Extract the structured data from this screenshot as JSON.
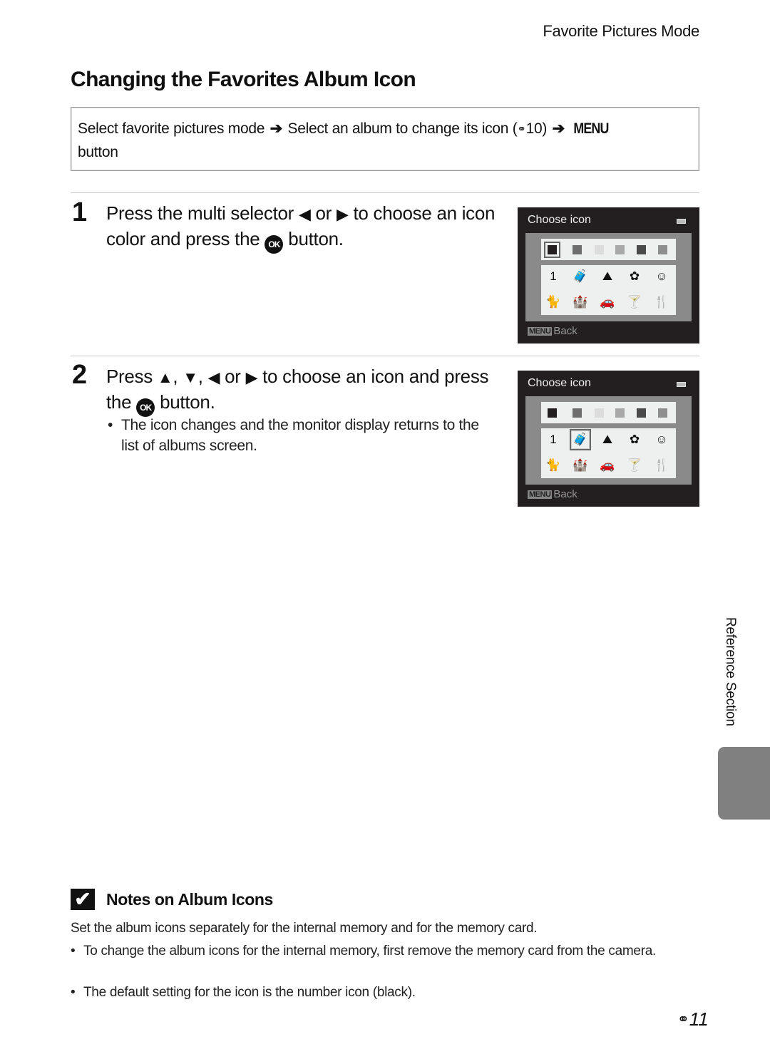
{
  "header": {
    "section": "Favorite Pictures Mode"
  },
  "title": "Changing the Favorites Album Icon",
  "navigation": {
    "part1": "Select favorite pictures mode",
    "arrow": "➔",
    "part2": "Select an album to change its icon (",
    "ref_icon": "⚭",
    "ref_page": "10)",
    "menu_label": "MENU",
    "part3": "button"
  },
  "steps": [
    {
      "number": "1",
      "text_a": "Press the multi selector ",
      "left": "◀",
      "or": " or ",
      "right": "▶",
      "text_b": " to choose an icon color and press the ",
      "ok": "OK",
      "text_c": " button."
    },
    {
      "number": "2",
      "text_a": "Press ",
      "up": "▲",
      "comma1": ", ",
      "down": "▼",
      "comma2": ", ",
      "left": "◀",
      "or": " or ",
      "right": "▶",
      "text_b": " to choose an icon and press the ",
      "ok": "OK",
      "text_c": " button.",
      "bullet": "The icon changes and the monitor display returns to the list of albums screen."
    }
  ],
  "camera_screens": [
    {
      "title": "Choose icon",
      "back_menu": "MENU",
      "back_label": "Back",
      "selected_swatch": 0,
      "selected_icon": "number"
    },
    {
      "title": "Choose icon",
      "back_menu": "MENU",
      "back_label": "Back",
      "selected_swatch": null,
      "selected_icon": "suitcase"
    }
  ],
  "swatch_colors": [
    "#231f20",
    "#6e6e6e",
    "#dcdcdc",
    "#a8a8a8",
    "#4a4a4a",
    "#8e8e8e"
  ],
  "icons": {
    "number": "1",
    "suitcase": "🧳",
    "mountain": "⛰",
    "flower": "✿",
    "face": "☺",
    "cat": "🐈",
    "castle": "🏰",
    "car": "🚗",
    "cocktail": "🍸",
    "cutlery": "🍴"
  },
  "side": {
    "label": "Reference Section"
  },
  "notes": {
    "icon": "✔",
    "title": "Notes on Album Icons",
    "body": "Set the album icons separately for the internal memory and for the memory card.",
    "bullets": [
      "To change the album icons for the internal memory, first remove the memory card from the camera.",
      "The default setting for the icon is the number icon (black)."
    ]
  },
  "footer": {
    "ref_icon": "⚭",
    "page": "11"
  }
}
